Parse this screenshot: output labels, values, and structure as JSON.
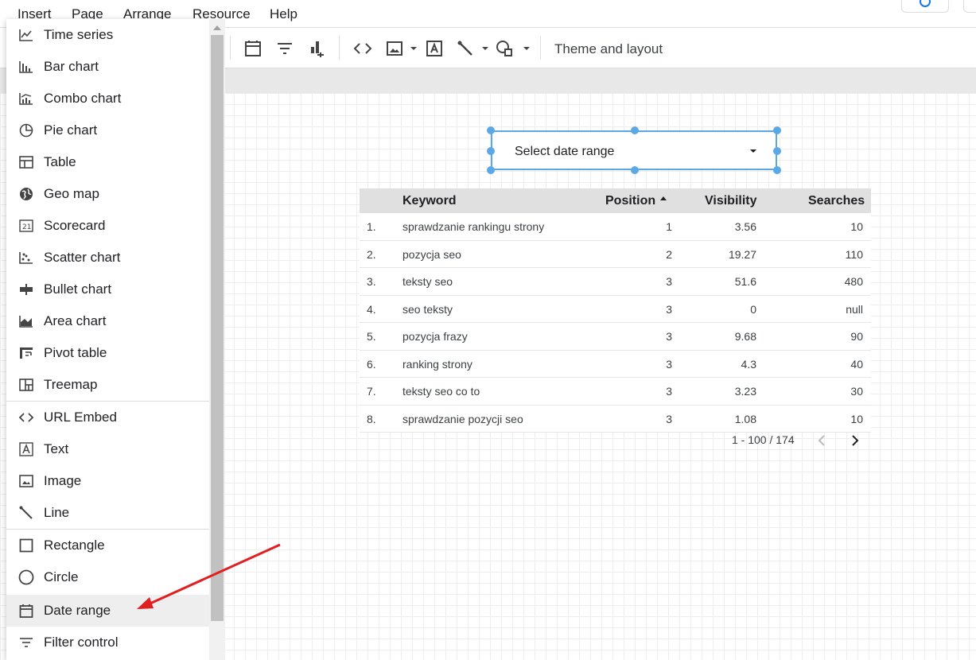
{
  "menubar": {
    "items": [
      "Insert",
      "Page",
      "Arrange",
      "Resource",
      "Help"
    ]
  },
  "toolbar": {
    "icons": [
      "date-range-icon",
      "filter-icon",
      "data-control-icon",
      "url-embed-icon",
      "image-icon",
      "text-icon",
      "line-icon",
      "shape-icon"
    ],
    "theme_label": "Theme and layout"
  },
  "date_control": {
    "label": "Select date range"
  },
  "table": {
    "headers": {
      "keyword": "Keyword",
      "position": "Position",
      "visibility": "Visibility",
      "searches": "Searches"
    },
    "rows": [
      {
        "idx": "1.",
        "keyword": "sprawdzanie rankingu strony",
        "position": "1",
        "visibility": "3.56",
        "searches": "10"
      },
      {
        "idx": "2.",
        "keyword": "pozycja seo",
        "position": "2",
        "visibility": "19.27",
        "searches": "110"
      },
      {
        "idx": "3.",
        "keyword": "teksty seo",
        "position": "3",
        "visibility": "51.6",
        "searches": "480"
      },
      {
        "idx": "4.",
        "keyword": "seo teksty",
        "position": "3",
        "visibility": "0",
        "searches": "null"
      },
      {
        "idx": "5.",
        "keyword": "pozycja frazy",
        "position": "3",
        "visibility": "9.68",
        "searches": "90"
      },
      {
        "idx": "6.",
        "keyword": "ranking strony",
        "position": "3",
        "visibility": "4.3",
        "searches": "40"
      },
      {
        "idx": "7.",
        "keyword": "teksty seo co to",
        "position": "3",
        "visibility": "3.23",
        "searches": "30"
      },
      {
        "idx": "8.",
        "keyword": "sprawdzanie pozycji seo",
        "position": "3",
        "visibility": "1.08",
        "searches": "10"
      }
    ],
    "pagination": "1 - 100 / 174"
  },
  "insert_menu": {
    "items": [
      {
        "label": "Time series",
        "icon": "time-series-icon"
      },
      {
        "label": "Bar chart",
        "icon": "bar-chart-icon"
      },
      {
        "label": "Combo chart",
        "icon": "combo-chart-icon"
      },
      {
        "label": "Pie chart",
        "icon": "pie-chart-icon"
      },
      {
        "label": "Table",
        "icon": "table-icon"
      },
      {
        "label": "Geo map",
        "icon": "geo-map-icon"
      },
      {
        "label": "Scorecard",
        "icon": "scorecard-icon"
      },
      {
        "label": "Scatter chart",
        "icon": "scatter-chart-icon"
      },
      {
        "label": "Bullet chart",
        "icon": "bullet-chart-icon"
      },
      {
        "label": "Area chart",
        "icon": "area-chart-icon"
      },
      {
        "label": "Pivot table",
        "icon": "pivot-table-icon"
      },
      {
        "label": "Treemap",
        "icon": "treemap-icon"
      },
      {
        "label": "URL Embed",
        "icon": "url-embed-icon"
      },
      {
        "label": "Text",
        "icon": "text-icon"
      },
      {
        "label": "Image",
        "icon": "image-icon"
      },
      {
        "label": "Line",
        "icon": "line-icon"
      },
      {
        "label": "Rectangle",
        "icon": "rectangle-icon"
      },
      {
        "label": "Circle",
        "icon": "circle-icon"
      },
      {
        "label": "Date range",
        "icon": "date-range-icon"
      },
      {
        "label": "Filter control",
        "icon": "filter-icon"
      }
    ],
    "highlighted": "Date range"
  },
  "colors": {
    "selection": "#5aa9e6",
    "annotation_arrow": "#e02020",
    "header_bg": "#e0e0e0"
  }
}
